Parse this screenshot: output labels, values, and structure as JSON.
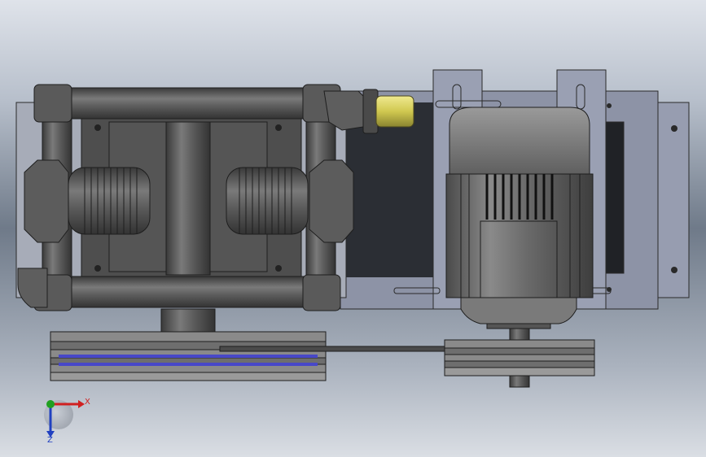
{
  "viewport": {
    "background_top": "#dfe3ea",
    "background_mid": "#7f8a9a",
    "background_bottom": "#d9dde3"
  },
  "model": {
    "parts": [
      "diaphragm-pump",
      "electric-motor",
      "motor-mount-plate",
      "pump-pulley",
      "motor-pulley",
      "drive-belt",
      "inlet-fitting",
      "outlet-fitting",
      "yellow-coupler"
    ],
    "colors": {
      "pump_body": "#5c5c5c",
      "pump_dark": "#3e3e3e",
      "motor_body": "#6a6a6a",
      "plate": "#8f95a8",
      "belt_accent": "#4848c8",
      "coupler": "#d8d060"
    }
  },
  "triad": {
    "x_label": "X",
    "z_label": "Z",
    "x_color": "#d02020",
    "y_color": "#20a020",
    "z_color": "#2040c0"
  }
}
